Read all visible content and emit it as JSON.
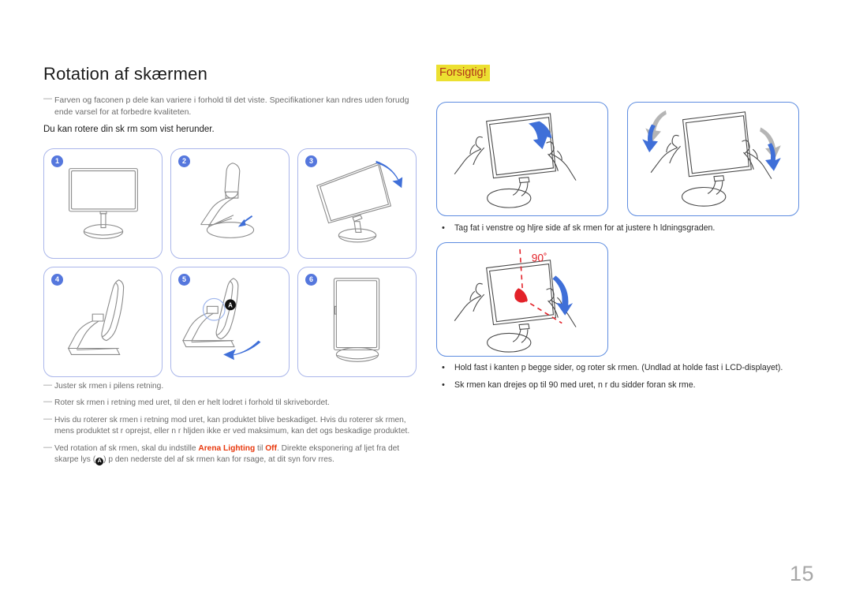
{
  "document": {
    "title": "Rotation af skærmen",
    "page_number": "15"
  },
  "left": {
    "note": "Farven og faconen p  dele kan variere i forhold til det viste. Specifikationer kan  ndres uden forudg ende varsel for at forbedre kvaliteten.",
    "lead": "Du kan rotere din sk rm som vist herunder.",
    "steps": [
      {
        "number": "1",
        "art": "monitor-front",
        "caption": ""
      },
      {
        "number": "2",
        "art": "monitor-stand-side",
        "caption": ""
      },
      {
        "number": "3",
        "art": "monitor-tilted-arrow",
        "caption": ""
      },
      {
        "number": "4",
        "art": "monitor-profile",
        "caption": ""
      },
      {
        "number": "5",
        "art": "monitor-profile-arrow-a",
        "caption": ""
      },
      {
        "number": "6",
        "art": "monitor-portrait",
        "caption": ""
      }
    ],
    "notes": [
      "Juster sk rmen i pilens retning.",
      "Roter sk rmen i retning med uret, til den er helt lodret i forhold til skrivebordet.",
      "Hvis du roterer sk rmen i retning mod uret, kan produktet blive beskadiget. Hvis du roterer sk rmen, mens produktet st r oprejst, eller n r hljden ikke er ved maksimum, kan det ogs  beskadige produktet."
    ],
    "note_arena_pre": "Ved rotation af sk rmen, skal du indstille ",
    "note_arena_term": "Arena Lighting",
    "note_arena_mid": " til ",
    "note_arena_off": "Off",
    "note_arena_post": ". Direkte eksponering af ljet fra det skarpe lys (",
    "note_arena_end": ") p  den nederste del af sk rmen kan for rsage, at dit syn forv rres.",
    "a_badge_label": "A"
  },
  "right": {
    "caution_label": "Forsigtig!",
    "panels": [
      {
        "art": "hands-tilt-down",
        "angle_label": ""
      },
      {
        "art": "hands-rotate-both",
        "angle_label": ""
      },
      {
        "art": "hands-rotate-90",
        "angle_label": "90˚"
      }
    ],
    "bullets": [
      "Tag fat i venstre og hljre side af sk rmen for at justere h ldningsgraden.",
      "Hold fast i kanten p  begge sider, og roter sk rmen. (Undlad at holde fast i LCD-displayet).",
      "Sk rmen kan drejes op til 90  med uret, n r du sidder foran sk rme."
    ]
  },
  "colors": {
    "accent_blue": "#5577dd",
    "panel_border_light": "#aab6ea",
    "panel_border_blue": "#5d8ce0",
    "highlight_yellow": "#ece031",
    "caution_text": "#b1341a",
    "red_term": "#e8380d",
    "arrow_blue": "#3f6fd8",
    "arrow_gray": "#b5b5b5",
    "page_number_gray": "#a7a7a7"
  }
}
